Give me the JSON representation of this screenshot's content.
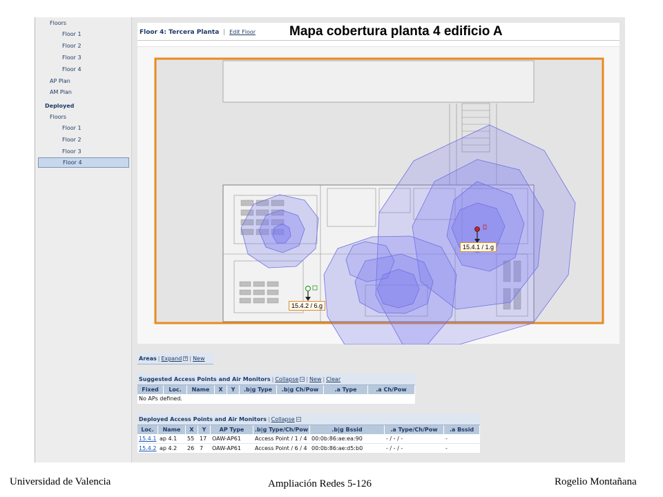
{
  "sidebar": {
    "items": [
      {
        "label": "Floors",
        "level": 1
      },
      {
        "label": "Floor 1",
        "level": 2
      },
      {
        "label": "Floor 2",
        "level": 2
      },
      {
        "label": "Floor 3",
        "level": 2
      },
      {
        "label": "Floor 4",
        "level": 2
      },
      {
        "label": "AP Plan",
        "level": 1
      },
      {
        "label": "AM Plan",
        "level": 1
      },
      {
        "label": "Deployed",
        "level": 0
      },
      {
        "label": "Floors",
        "level": 1
      },
      {
        "label": "Floor 1",
        "level": 2
      },
      {
        "label": "Floor 2",
        "level": 2
      },
      {
        "label": "Floor 3",
        "level": 2
      },
      {
        "label": "Floor 4",
        "level": 2,
        "selected": true
      }
    ]
  },
  "header": {
    "floor_title": "Floor 4: Tercera Planta",
    "separator": "|",
    "edit_floor_label": "Edit Floor"
  },
  "overlay_title": "Mapa cobertura planta 4 edificio A",
  "map": {
    "ap_labels": [
      "15.4.1 / 1.g",
      "15.4.2 / 6.g"
    ],
    "colors": {
      "coverage": "#8c8cf0",
      "border": "#e98a1f",
      "ap_marker": "#cc2020"
    }
  },
  "areas": {
    "title": "Areas",
    "sep1": "|",
    "expand_label": "Expand",
    "expand_icon": "+",
    "sep2": "|",
    "new_label": "New"
  },
  "suggested": {
    "title": "Suggested Access Points and Air Monitors",
    "sep1": "|",
    "collapse_label": "Collapse",
    "collapse_icon": "−",
    "sep2": "|",
    "new_label": "New",
    "sep3": "|",
    "clear_label": "Clear",
    "columns": [
      "Fixed",
      "Loc.",
      "Name",
      "X",
      "Y",
      ".b|g Type",
      ".b|g Ch/Pow",
      ".a Type",
      ".a Ch/Pow"
    ],
    "empty_text": "No APs defined."
  },
  "deployed": {
    "title": "Deployed Access Points and Air Monitors",
    "sep1": "|",
    "collapse_label": "Collapse",
    "collapse_icon": "−",
    "columns": [
      "Loc.",
      "Name",
      "X",
      "Y",
      "AP Type",
      ".b|g Type/Ch/Pow",
      ".b|g Bssid",
      ".a Type/Ch/Pow",
      ".a Bssid"
    ],
    "rows": [
      [
        "15.4.1",
        "ap 4.1",
        "55",
        "17",
        "OAW-AP61",
        "Access Point / 1 / 4",
        "00:0b:86:ae:ea:90",
        "- / - / -",
        "-"
      ],
      [
        "15.4.2",
        "ap 4.2",
        "26",
        "7",
        "OAW-AP61",
        "Access Point / 6 / 4",
        "00:0b:86:ae:d5:b0",
        "- / - / -",
        "-"
      ]
    ]
  },
  "footer": {
    "left": "Universidad de Valencia",
    "center": "Ampliación Redes 5-126",
    "right": "Rogelio Montañana"
  }
}
